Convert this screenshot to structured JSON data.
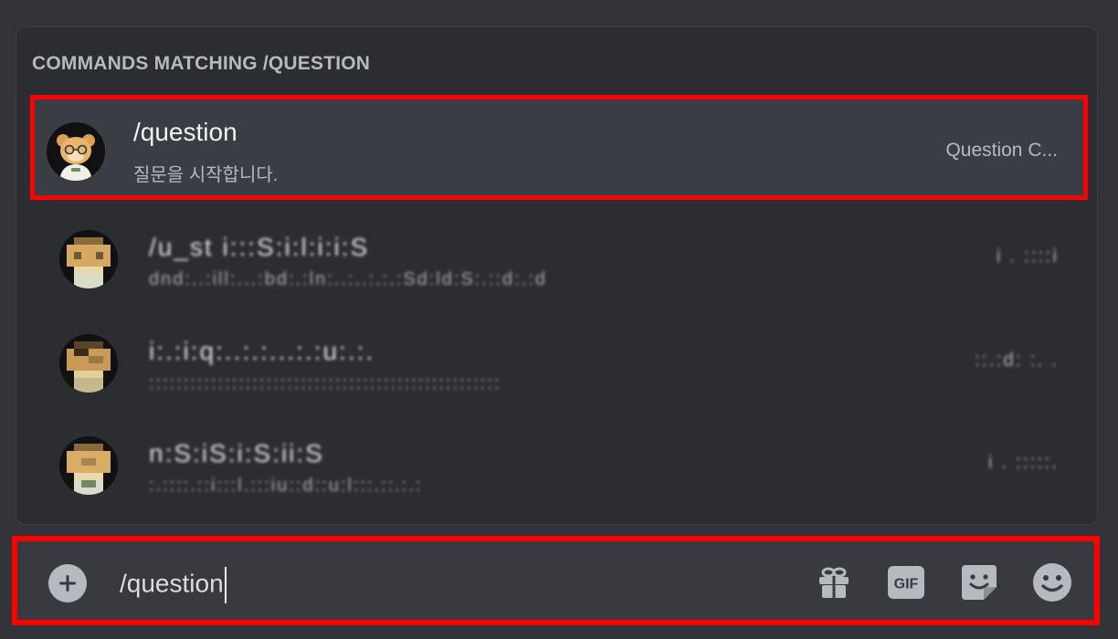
{
  "popup": {
    "header": "COMMANDS MATCHING /QUESTION",
    "commands": [
      {
        "name": "/question",
        "description": "질문을 시작합니다.",
        "source": "Question C..."
      },
      {
        "name": "/u_st  i:::S:i:l:i:i:S",
        "description": "dnd:..:ill:...:bd:.:ln:..:..:.:.:Sd:ld:S:.::d:.:d",
        "source": "i . ::::i"
      },
      {
        "name": "i:.:i:q:..:.:...:.:u:.:.",
        "description": ":::::::::::::::::::::::::::::::::::::::::::::::::::",
        "source": "::.:d: :. ."
      },
      {
        "name": "n:S:iS:i:S:ii:S",
        "description": ":.::::.::i:::l.:::iu::d::u:l:::.::.:.:",
        "source": "i . :::::."
      }
    ]
  },
  "composer": {
    "input_value": "/question",
    "icons": [
      "plus-circle-icon",
      "gift-icon",
      "gif-icon",
      "sticker-icon",
      "emoji-icon"
    ],
    "gif_label": "GIF"
  },
  "colors": {
    "background": "#313338",
    "popup": "#2b2d31",
    "selected_row": "#3b3d44",
    "highlight_border": "#ff0000",
    "icon_gray": "#b5bac1"
  }
}
